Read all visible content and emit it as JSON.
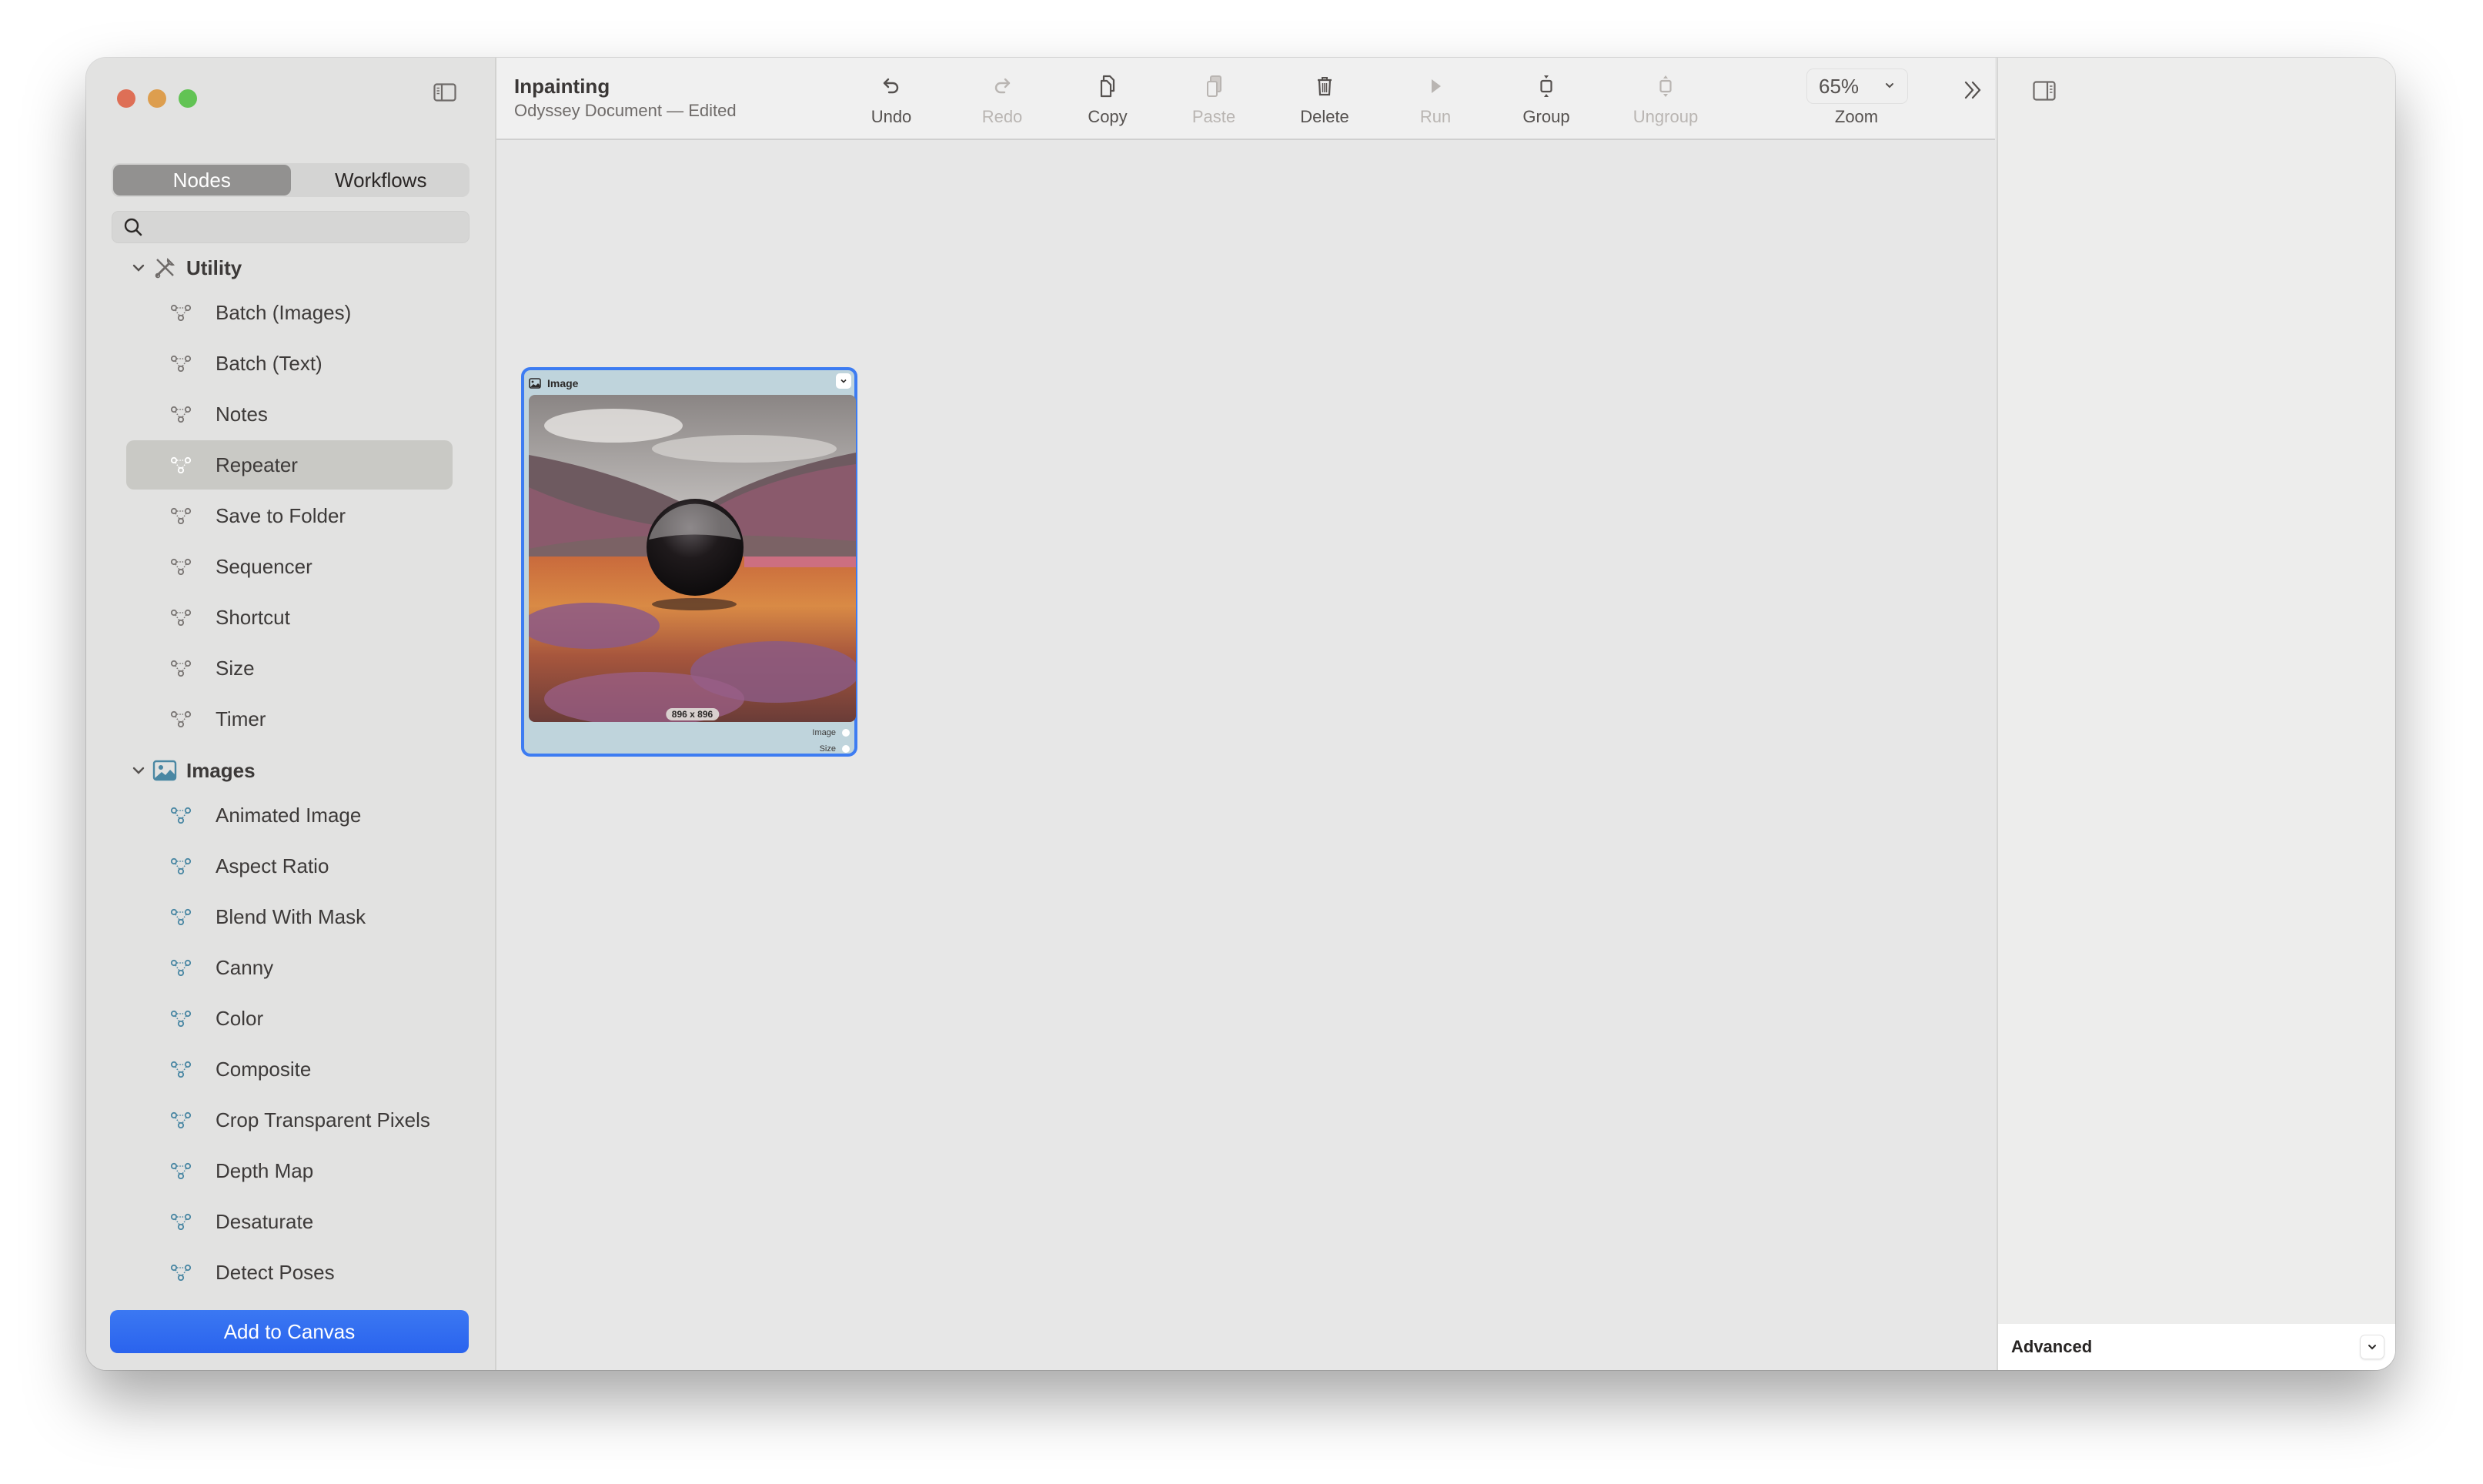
{
  "window": {
    "traffic_lights": [
      "close",
      "minimize",
      "zoom"
    ]
  },
  "sidebar": {
    "tabs": [
      {
        "label": "Nodes",
        "active": true
      },
      {
        "label": "Workflows",
        "active": false
      }
    ],
    "search": {
      "value": "",
      "placeholder": ""
    },
    "groups": [
      {
        "label": "Utility",
        "icon": "tools-icon",
        "expanded": true,
        "icon_color": "#7a7674",
        "items": [
          {
            "label": "Batch (Images)",
            "selected": false
          },
          {
            "label": "Batch (Text)",
            "selected": false
          },
          {
            "label": "Notes",
            "selected": false
          },
          {
            "label": "Repeater",
            "selected": true
          },
          {
            "label": "Save to Folder",
            "selected": false
          },
          {
            "label": "Sequencer",
            "selected": false
          },
          {
            "label": "Shortcut",
            "selected": false
          },
          {
            "label": "Size",
            "selected": false
          },
          {
            "label": "Timer",
            "selected": false
          }
        ]
      },
      {
        "label": "Images",
        "icon": "photo-icon",
        "expanded": true,
        "icon_color": "#4a87a3",
        "items": [
          {
            "label": "Animated Image",
            "selected": false
          },
          {
            "label": "Aspect Ratio",
            "selected": false
          },
          {
            "label": "Blend With Mask",
            "selected": false
          },
          {
            "label": "Canny",
            "selected": false
          },
          {
            "label": "Color",
            "selected": false
          },
          {
            "label": "Composite",
            "selected": false
          },
          {
            "label": "Crop Transparent Pixels",
            "selected": false
          },
          {
            "label": "Depth Map",
            "selected": false
          },
          {
            "label": "Desaturate",
            "selected": false
          },
          {
            "label": "Detect Poses",
            "selected": false
          }
        ]
      }
    ],
    "add_button_label": "Add to Canvas"
  },
  "toolbar": {
    "title": "Inpainting",
    "subtitle": "Odyssey Document — Edited",
    "buttons": [
      {
        "id": "undo",
        "label": "Undo",
        "icon": "undo-icon",
        "enabled": true
      },
      {
        "id": "redo",
        "label": "Redo",
        "icon": "redo-icon",
        "enabled": false
      },
      {
        "id": "copy",
        "label": "Copy",
        "icon": "copy-icon",
        "enabled": true
      },
      {
        "id": "paste",
        "label": "Paste",
        "icon": "paste-icon",
        "enabled": false
      },
      {
        "id": "delete",
        "label": "Delete",
        "icon": "trash-icon",
        "enabled": true
      },
      {
        "id": "run",
        "label": "Run",
        "icon": "play-icon",
        "enabled": false
      },
      {
        "id": "group",
        "label": "Group",
        "icon": "group-icon",
        "enabled": true
      },
      {
        "id": "ungroup",
        "label": "Ungroup",
        "icon": "ungroup-icon",
        "enabled": false
      }
    ],
    "zoom": {
      "value": "65%",
      "label": "Zoom"
    }
  },
  "canvas": {
    "nodes": [
      {
        "title": "Image",
        "selected": true,
        "image_size": "896 x 896",
        "outputs": [
          "Image",
          "Size"
        ]
      }
    ]
  },
  "inspector": {
    "advanced_label": "Advanced"
  },
  "colors": {
    "accent": "#2a63ee",
    "selection_border": "#3d7cf2",
    "node_bg": "#bfd4dc"
  }
}
